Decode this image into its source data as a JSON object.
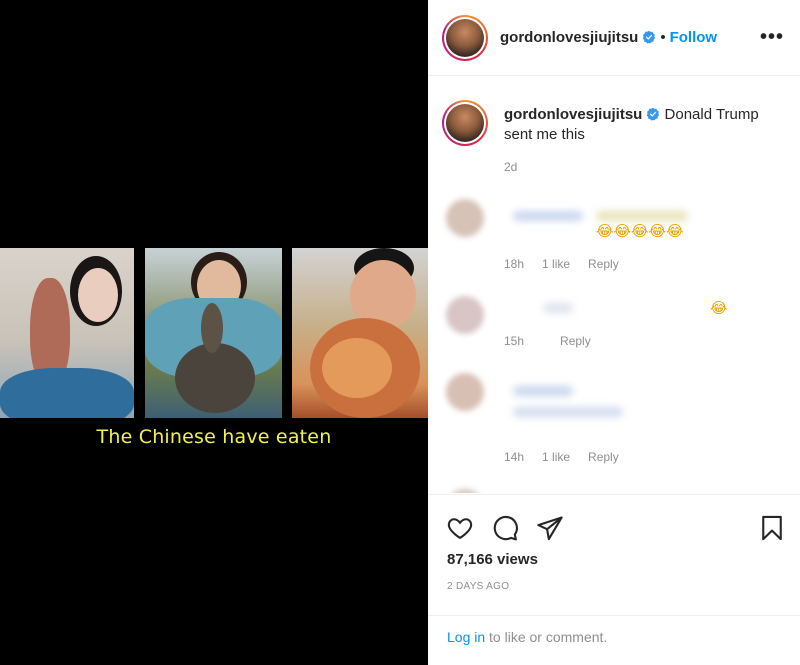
{
  "media": {
    "caption_overlay": "The Chinese have eaten"
  },
  "header": {
    "username": "gordonlovesjiujitsu",
    "separator": "•",
    "follow_label": "Follow",
    "more_label": "•••",
    "verified_icon": "verified-badge-icon"
  },
  "post_caption": {
    "username": "gordonlovesjiujitsu",
    "text": "Donald Trump sent me this",
    "time": "2d"
  },
  "comments": [
    {
      "emojis": "😂😂😂😂😂",
      "time": "18h",
      "likes": "1 like",
      "reply": "Reply"
    },
    {
      "emojis": "😂",
      "time": "15h",
      "likes": "",
      "reply": "Reply"
    },
    {
      "emojis": "",
      "time": "14h",
      "likes": "1 like",
      "reply": "Reply"
    }
  ],
  "actions": {
    "icons": [
      "heart-icon",
      "comment-icon",
      "share-icon",
      "bookmark-icon"
    ],
    "views": "87,166 views",
    "date": "2 DAYS AGO"
  },
  "login_prompt": {
    "link": "Log in",
    "text": " to like or comment."
  },
  "colors": {
    "accent": "#0095f6",
    "caption_overlay": "#f2f24a",
    "muted": "#8e8e8e"
  }
}
